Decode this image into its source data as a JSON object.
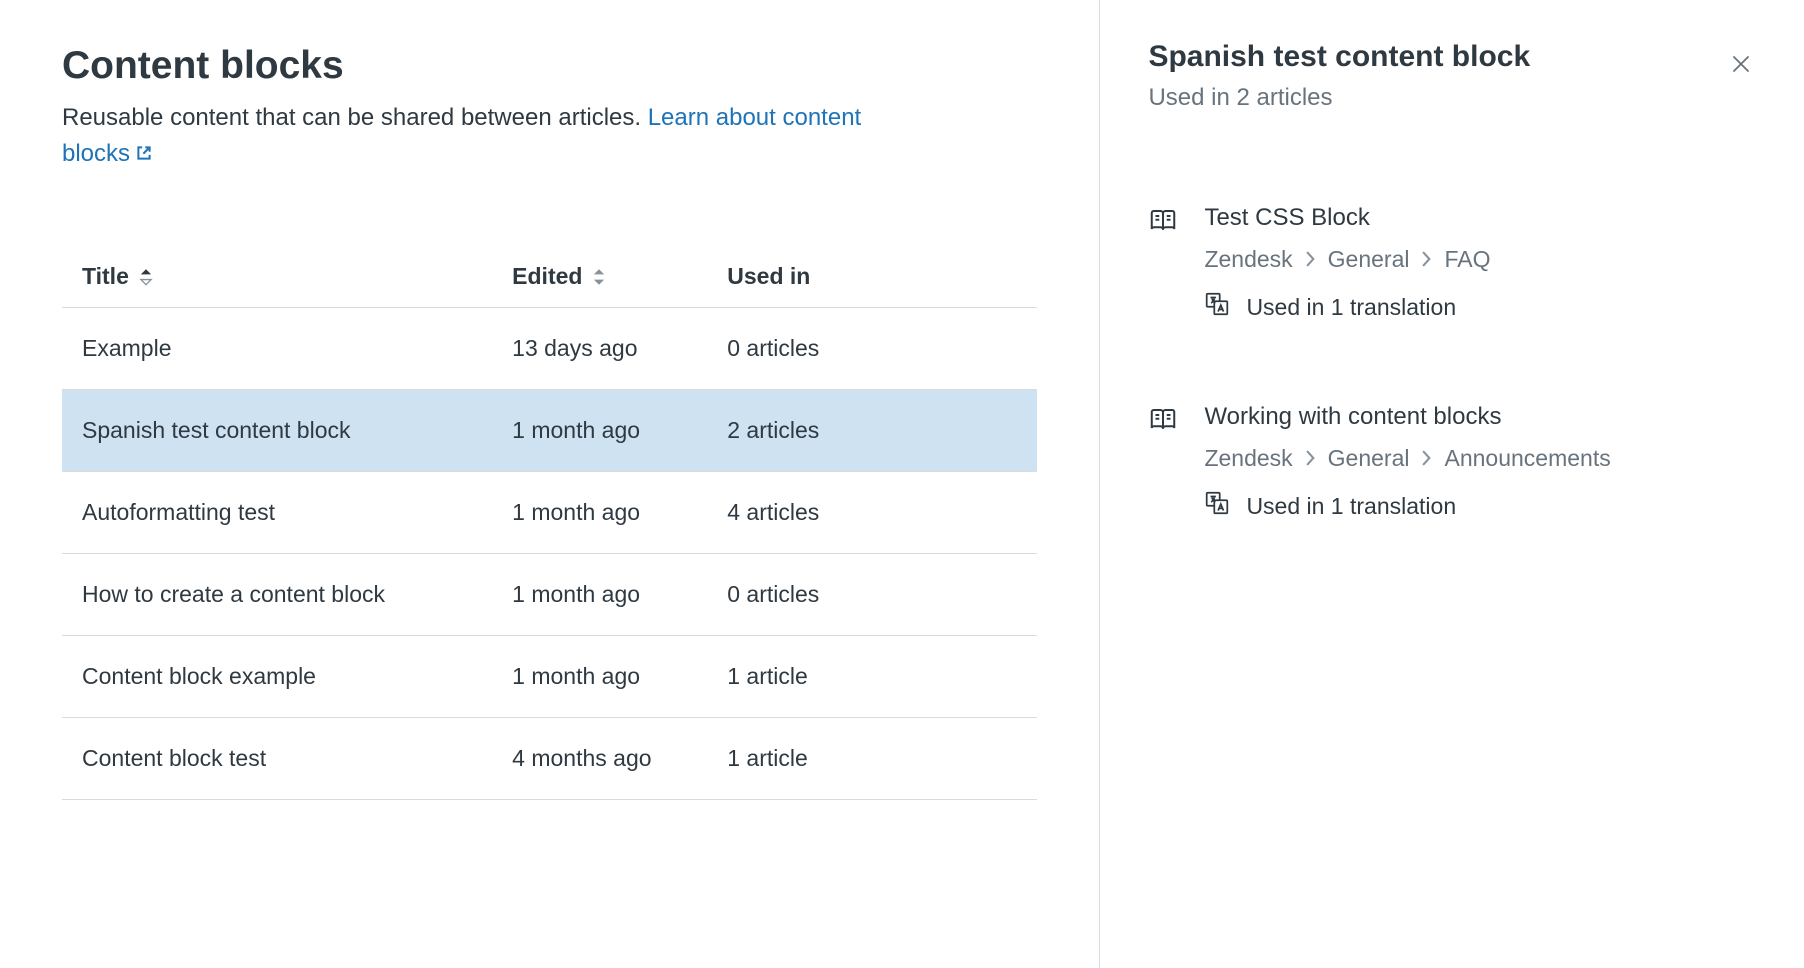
{
  "header": {
    "title": "Content blocks",
    "subtitle_text": "Reusable content that can be shared between articles. ",
    "learn_link": "Learn about content blocks"
  },
  "table": {
    "columns": {
      "title": "Title",
      "edited": "Edited",
      "used_in": "Used in"
    },
    "rows": [
      {
        "title": "Example",
        "edited": "13 days ago",
        "used_in": "0 articles"
      },
      {
        "title": "Spanish test content block",
        "edited": "1 month ago",
        "used_in": "2 articles"
      },
      {
        "title": "Autoformatting test",
        "edited": "1 month ago",
        "used_in": "4 articles"
      },
      {
        "title": "How to create a content block",
        "edited": "1 month ago",
        "used_in": "0 articles"
      },
      {
        "title": "Content block example",
        "edited": "1 month ago",
        "used_in": "1 article"
      },
      {
        "title": "Content block test",
        "edited": "4 months ago",
        "used_in": "1 article"
      }
    ],
    "selected_index": 1
  },
  "panel": {
    "title": "Spanish test content block",
    "subtitle": "Used in 2 articles",
    "articles": [
      {
        "title": "Test CSS Block",
        "breadcrumb": [
          "Zendesk",
          "General",
          "FAQ"
        ],
        "translation": "Used in 1 translation"
      },
      {
        "title": "Working with content blocks",
        "breadcrumb": [
          "Zendesk",
          "General",
          "Announcements"
        ],
        "translation": "Used in 1 translation"
      }
    ]
  }
}
